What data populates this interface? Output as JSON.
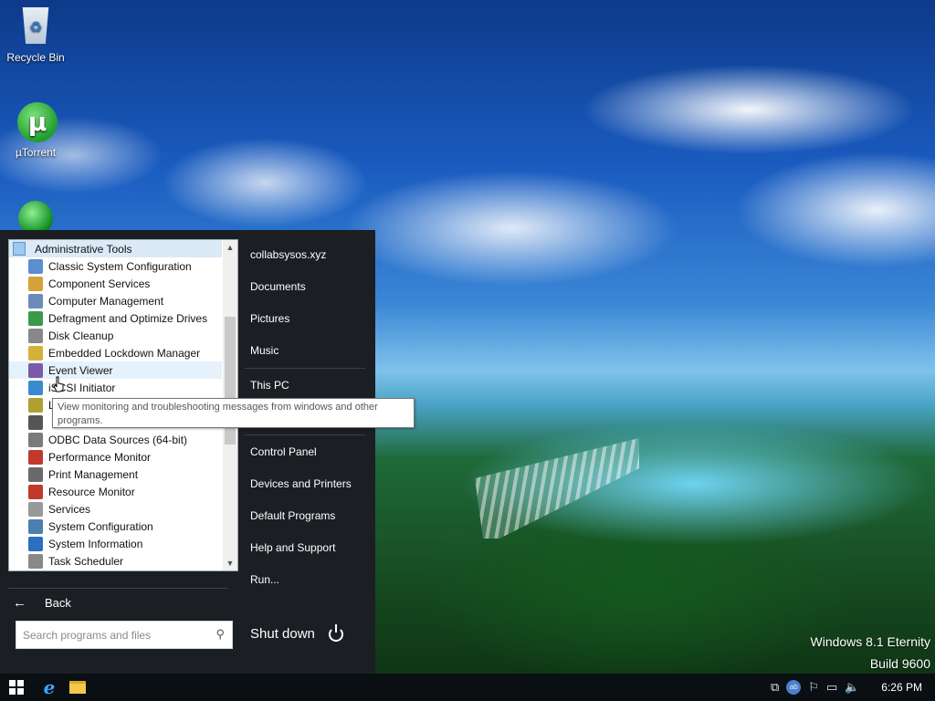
{
  "desktop": {
    "icons": [
      {
        "label": "Recycle Bin",
        "icon": "recycle-bin-icon"
      },
      {
        "label": "µTorrent",
        "icon": "utorrent-icon"
      }
    ],
    "watermark_line1": "Windows 8.1 Eternity",
    "watermark_line2": "Build 9600"
  },
  "start_menu": {
    "folder_label": "Administrative Tools",
    "programs": [
      {
        "label": "Classic System Configuration",
        "icon": "msconfig-icon"
      },
      {
        "label": "Component Services",
        "icon": "component-services-icon"
      },
      {
        "label": "Computer Management",
        "icon": "computer-management-icon"
      },
      {
        "label": "Defragment and Optimize Drives",
        "icon": "defragment-icon"
      },
      {
        "label": "Disk Cleanup",
        "icon": "disk-cleanup-icon"
      },
      {
        "label": "Embedded Lockdown Manager",
        "icon": "lock-icon"
      },
      {
        "label": "Event Viewer",
        "icon": "event-viewer-icon"
      },
      {
        "label": "iSCSI Initiator",
        "icon": "globe-icon"
      },
      {
        "label": "L",
        "icon": "security-policy-icon"
      },
      {
        "label": "",
        "icon": "memory-diagnostic-icon"
      },
      {
        "label": "ODBC Data Sources (64-bit)",
        "icon": "odbc-icon"
      },
      {
        "label": "Performance Monitor",
        "icon": "performance-monitor-icon"
      },
      {
        "label": "Print Management",
        "icon": "printer-icon"
      },
      {
        "label": "Resource Monitor",
        "icon": "resource-monitor-icon"
      },
      {
        "label": "Services",
        "icon": "services-icon"
      },
      {
        "label": "System Configuration",
        "icon": "system-configuration-icon"
      },
      {
        "label": "System Information",
        "icon": "system-information-icon"
      },
      {
        "label": "Task Scheduler",
        "icon": "task-scheduler-icon"
      }
    ],
    "hovered_program": "Event Viewer",
    "tooltip": "View monitoring and troubleshooting messages from windows and other programs.",
    "back_label": "Back",
    "search_placeholder": "Search programs and files",
    "right_items": [
      "collabsysos.xyz",
      "Documents",
      "Pictures",
      "Music",
      "This PC",
      "Control Panel",
      "Devices and Printers",
      "Default Programs",
      "Help and Support",
      "Run..."
    ],
    "shutdown_label": "Shut down"
  },
  "taskbar": {
    "pinned": [
      "start-button",
      "internet-explorer-icon",
      "file-explorer-icon"
    ],
    "tray": [
      "network-icon",
      "user-badge-icon",
      "flag-icon",
      "monitor-icon",
      "volume-icon"
    ],
    "user_badge": "ab",
    "clock": "6:26 PM"
  }
}
